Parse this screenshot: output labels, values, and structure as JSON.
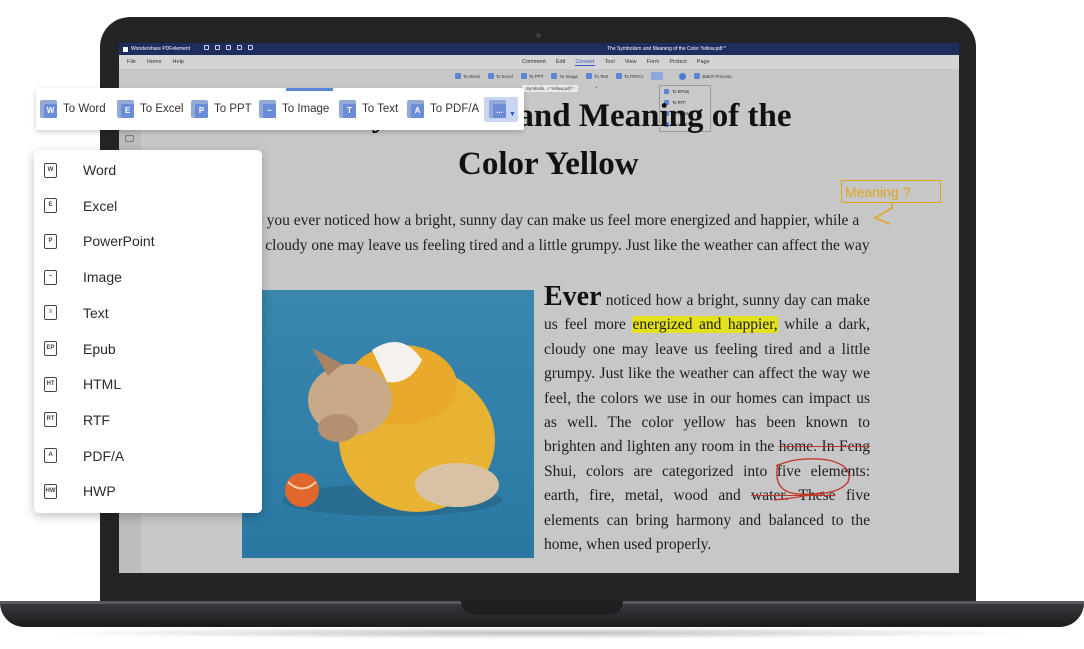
{
  "app": {
    "name": "Wondershare PDFelement",
    "document_title": "The Symbolism and Meaning of the Color Yellow.pdf *"
  },
  "menubar": {
    "left": [
      "File",
      "Home",
      "Help"
    ],
    "right": [
      "Comment",
      "Edit",
      "Convert",
      "Tool",
      "View",
      "Form",
      "Protect",
      "Page"
    ],
    "active": "Convert"
  },
  "small_toolbar": {
    "items": [
      "To Word",
      "To Excel",
      "To PPT",
      "To Image",
      "To Text",
      "To PDF/A"
    ],
    "batch": "Batch Process"
  },
  "tab": {
    "label": "Symbolis...r Yellow.pdf *",
    "close": "×",
    "plus": "+"
  },
  "mini_dropdown": [
    "To EPUB",
    "To RTF",
    "To HTML",
    "To HWP"
  ],
  "document": {
    "title_line1": "The Symbolism and Meaning of the",
    "title_line2": "Color Yellow",
    "intro": "Have you ever noticed how a bright, sunny day can make us feel more energized and happier, while a dark, cloudy one may leave us feeling tired and a little grumpy. Just like the weather can affect the way ...",
    "column": {
      "dropcap": "Ever",
      "part1": " noticed how a bright, sunny day can make us feel more ",
      "highlight": "energized and happier,",
      "part2": " while a dark, cloudy one may leave us feeling tired and a little grumpy. Just like the weather can affect the way we feel, the colors we use in our homes can impact us as well. The color yellow has been known to brighten and lighten any room in the ",
      "strike1": "home. In Feng",
      "part3": " Shui, colors are categorized into ",
      "circled": "five elements",
      "part4": ": earth, fire, metal, wood and ",
      "strike2": "water. These",
      "part5": " five elements can bring harmony and balanced to the home, when used properly."
    }
  },
  "annotation": {
    "note": "Meaning ?",
    "color": "#e1a21a"
  },
  "convert_bar": {
    "items": [
      {
        "label": "To Word",
        "glyph": "W"
      },
      {
        "label": "To Excel",
        "glyph": "E"
      },
      {
        "label": "To PPT",
        "glyph": "P"
      },
      {
        "label": "To Image",
        "glyph": "~"
      },
      {
        "label": "To Text",
        "glyph": "T"
      },
      {
        "label": "To PDF/A",
        "glyph": "A"
      }
    ],
    "more_glyph": "...",
    "accent": "#5b86d6"
  },
  "format_menu": {
    "items": [
      {
        "label": "Word",
        "icon": "W"
      },
      {
        "label": "Excel",
        "icon": "E"
      },
      {
        "label": "PowerPoint",
        "icon": "P"
      },
      {
        "label": "Image",
        "icon": "~"
      },
      {
        "label": "Text",
        "icon": "≡"
      },
      {
        "label": "Epub",
        "icon": "EP"
      },
      {
        "label": "HTML",
        "icon": "HT"
      },
      {
        "label": "RTF",
        "icon": "RT"
      },
      {
        "label": "PDF/A",
        "icon": "A"
      },
      {
        "label": "HWP",
        "icon": "HW"
      }
    ]
  }
}
